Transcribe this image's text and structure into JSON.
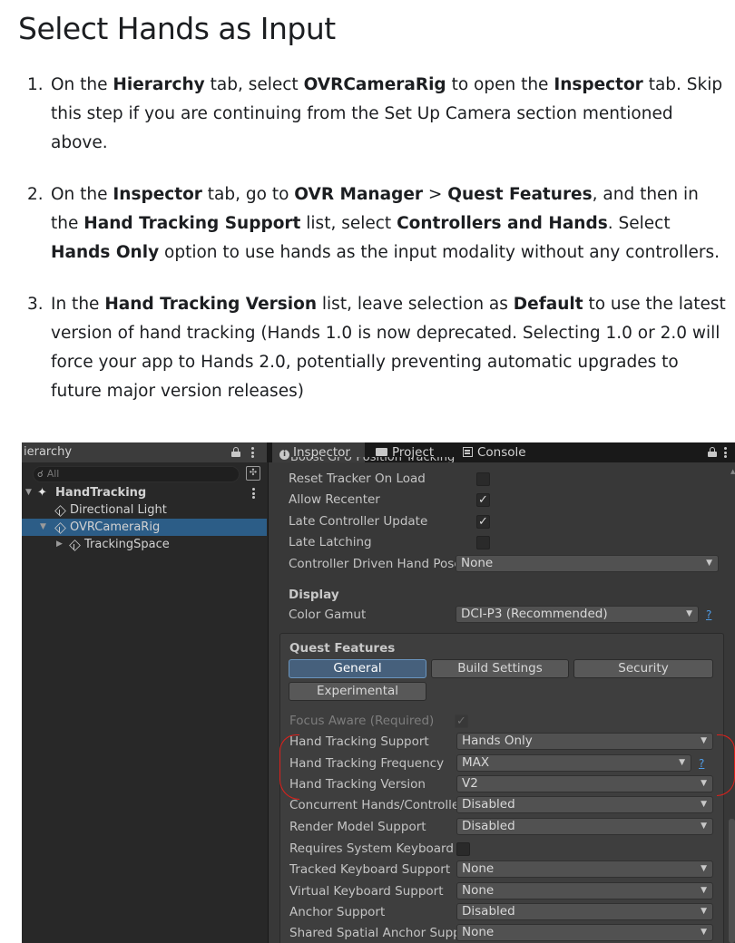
{
  "document": {
    "title": "Select Hands as Input",
    "steps": [
      {
        "number": "1.",
        "segments": [
          {
            "text": "On the "
          },
          {
            "text": "Hierarchy",
            "bold": true
          },
          {
            "text": " tab, select "
          },
          {
            "text": "OVRCameraRig",
            "bold": true
          },
          {
            "text": " to open the "
          },
          {
            "text": "Inspector",
            "bold": true
          },
          {
            "text": " tab. Skip this step if you are continuing from the Set Up Camera section mentioned above."
          }
        ]
      },
      {
        "number": "2.",
        "segments": [
          {
            "text": "On the "
          },
          {
            "text": "Inspector",
            "bold": true
          },
          {
            "text": " tab, go to "
          },
          {
            "text": "OVR Manager",
            "bold": true
          },
          {
            "text": " > "
          },
          {
            "text": "Quest Features",
            "bold": true
          },
          {
            "text": ", and then in the "
          },
          {
            "text": "Hand Tracking Support",
            "bold": true
          },
          {
            "text": " list, select "
          },
          {
            "text": "Controllers and Hands",
            "bold": true
          },
          {
            "text": ". Select "
          },
          {
            "text": "Hands Only",
            "bold": true
          },
          {
            "text": " option to use hands as the input modality without any controllers."
          }
        ]
      },
      {
        "number": "3.",
        "segments": [
          {
            "text": "In the "
          },
          {
            "text": "Hand Tracking Version",
            "bold": true
          },
          {
            "text": " list, leave selection as "
          },
          {
            "text": "Default",
            "bold": true
          },
          {
            "text": " to use the latest version of hand tracking (Hands 1.0 is now deprecated. Selecting 1.0 or 2.0 will force your app to Hands 2.0, potentially preventing automatic upgrades to future major version releases)"
          }
        ]
      }
    ]
  },
  "hierarchy": {
    "tab_label": "ierarchy",
    "search_placeholder": "All",
    "items": [
      {
        "label": "HandTracking",
        "icon": "unity-scene-icon"
      },
      {
        "label": "Directional Light",
        "icon": "cube-icon"
      },
      {
        "label": "OVRCameraRig",
        "icon": "cube-icon",
        "selected": true
      },
      {
        "label": "TrackingSpace",
        "icon": "cube-icon"
      }
    ]
  },
  "inspector": {
    "tabs": {
      "inspector": "Inspector",
      "project": "Project",
      "console": "Console"
    },
    "cutoff_text": "Boost GPU Position Tracking",
    "rows": [
      {
        "label": "Reset Tracker On Load",
        "checked": false
      },
      {
        "label": "Allow Recenter",
        "checked": true
      },
      {
        "label": "Late Controller Update",
        "checked": true
      },
      {
        "label": "Late Latching",
        "checked": false
      }
    ],
    "controller_driven": {
      "label": "Controller Driven Hand Poses",
      "value": "None"
    },
    "display": {
      "title": "Display",
      "color_gamut": {
        "label": "Color Gamut",
        "value": "DCI-P3 (Recommended)",
        "help": "?"
      }
    },
    "quest_features": {
      "title": "Quest Features",
      "tabs": [
        "General",
        "Build Settings",
        "Security",
        "Experimental"
      ],
      "active_tab": "General",
      "focus_aware": {
        "label": "Focus Aware (Required)",
        "checked": true
      },
      "rows": [
        {
          "label": "Hand Tracking Support",
          "value": "Hands Only"
        },
        {
          "label": "Hand Tracking Frequency",
          "value": "MAX",
          "help": "?"
        },
        {
          "label": "Hand Tracking Version",
          "value": "V2"
        },
        {
          "label": "Concurrent Hands/Controllers",
          "value": "Disabled"
        },
        {
          "label": "Render Model Support",
          "value": "Disabled"
        },
        {
          "label": "Requires System Keyboard",
          "checkbox": true
        },
        {
          "label": "Tracked Keyboard Support",
          "value": "None"
        },
        {
          "label": "Virtual Keyboard Support",
          "value": "None"
        },
        {
          "label": "Anchor Support",
          "value": "Disabled"
        },
        {
          "label": "Shared Spatial Anchor Support",
          "value": "None"
        }
      ]
    }
  },
  "annotation_color": "#e0201b"
}
